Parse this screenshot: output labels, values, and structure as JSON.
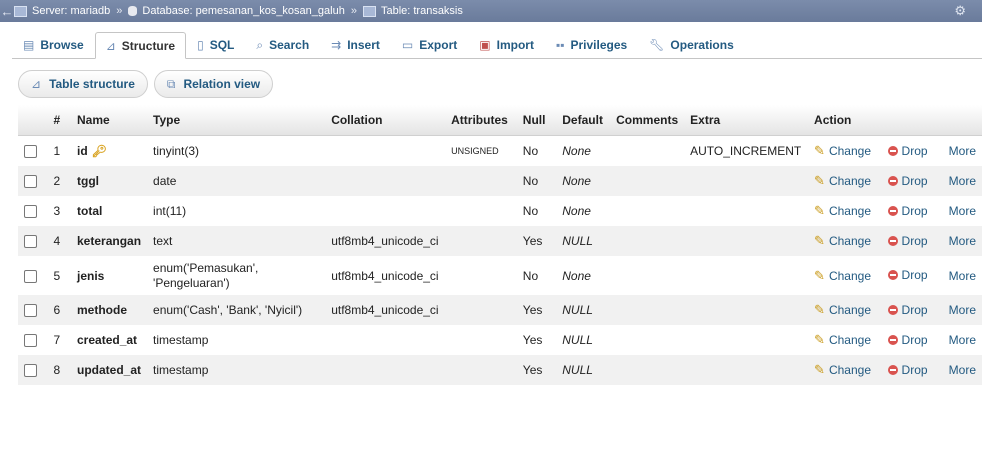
{
  "breadcrumb": {
    "server": "Server: mariadb",
    "database": "Database: pemesanan_kos_kosan_galuh",
    "table": "Table: transaksis",
    "separator": "»"
  },
  "tabs": [
    {
      "label": "Browse",
      "icon": "browse-icon"
    },
    {
      "label": "Structure",
      "icon": "structure-icon",
      "active": true
    },
    {
      "label": "SQL",
      "icon": "sql-icon"
    },
    {
      "label": "Search",
      "icon": "search-icon"
    },
    {
      "label": "Insert",
      "icon": "insert-icon"
    },
    {
      "label": "Export",
      "icon": "export-icon"
    },
    {
      "label": "Import",
      "icon": "import-icon"
    },
    {
      "label": "Privileges",
      "icon": "privileges-icon"
    },
    {
      "label": "Operations",
      "icon": "wrench-icon"
    }
  ],
  "subtabs": {
    "table_structure": "Table structure",
    "relation_view": "Relation view"
  },
  "columns": {
    "hash": "#",
    "name": "Name",
    "type": "Type",
    "collation": "Collation",
    "attributes": "Attributes",
    "null": "Null",
    "default": "Default",
    "comments": "Comments",
    "extra": "Extra",
    "action": "Action"
  },
  "actions": {
    "change": "Change",
    "drop": "Drop",
    "more": "More"
  },
  "rows": [
    {
      "n": "1",
      "name": "id",
      "type": "tinyint(3)",
      "collation": "",
      "attributes": "UNSIGNED",
      "null": "No",
      "default": "None",
      "extra": "AUTO_INCREMENT",
      "key": true
    },
    {
      "n": "2",
      "name": "tggl",
      "type": "date",
      "collation": "",
      "attributes": "",
      "null": "No",
      "default": "None",
      "extra": ""
    },
    {
      "n": "3",
      "name": "total",
      "type": "int(11)",
      "collation": "",
      "attributes": "",
      "null": "No",
      "default": "None",
      "extra": ""
    },
    {
      "n": "4",
      "name": "keterangan",
      "type": "text",
      "collation": "utf8mb4_unicode_ci",
      "attributes": "",
      "null": "Yes",
      "default": "NULL",
      "extra": ""
    },
    {
      "n": "5",
      "name": "jenis",
      "type": "enum('Pemasukan', 'Pengeluaran')",
      "collation": "utf8mb4_unicode_ci",
      "attributes": "",
      "null": "No",
      "default": "None",
      "extra": ""
    },
    {
      "n": "6",
      "name": "methode",
      "type": "enum('Cash', 'Bank', 'Nyicil')",
      "collation": "utf8mb4_unicode_ci",
      "attributes": "",
      "null": "Yes",
      "default": "NULL",
      "extra": ""
    },
    {
      "n": "7",
      "name": "created_at",
      "type": "timestamp",
      "collation": "",
      "attributes": "",
      "null": "Yes",
      "default": "NULL",
      "extra": ""
    },
    {
      "n": "8",
      "name": "updated_at",
      "type": "timestamp",
      "collation": "",
      "attributes": "",
      "null": "Yes",
      "default": "NULL",
      "extra": ""
    }
  ]
}
